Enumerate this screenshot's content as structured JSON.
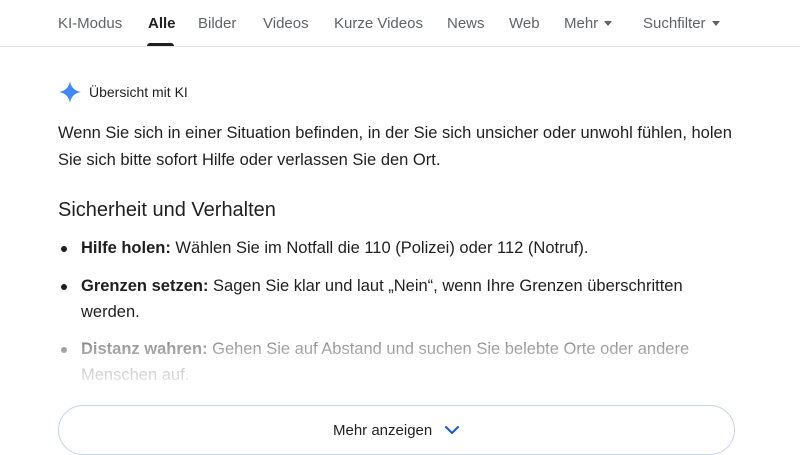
{
  "tabs": [
    {
      "label": "KI-Modus"
    },
    {
      "label": "Alle",
      "active": true
    },
    {
      "label": "Bilder"
    },
    {
      "label": "Videos"
    },
    {
      "label": "Kurze Videos"
    },
    {
      "label": "News"
    },
    {
      "label": "Web"
    },
    {
      "label": "Mehr",
      "dropdown": true
    },
    {
      "label": "Suchfilter",
      "dropdown": true
    }
  ],
  "ai_overview": {
    "icon": "sparkle-icon",
    "label": "Übersicht mit KI",
    "intro": "Wenn Sie sich in einer Situation befinden, in der Sie sich unsicher oder unwohl fühlen, holen Sie sich bitte sofort Hilfe oder verlassen Sie den Ort.",
    "section_title": "Sicherheit und Verhalten",
    "bullets": [
      {
        "title": "Hilfe holen:",
        "text": " Wählen Sie im Notfall die 110 (Polizei) oder 112 (Notruf)."
      },
      {
        "title": "Grenzen setzen:",
        "text": " Sagen Sie klar und laut „Nein“, wenn Ihre Grenzen überschritten werden."
      },
      {
        "title": "Distanz wahren:",
        "text": " Gehen Sie auf Abstand und suchen Sie belebte Orte oder andere Menschen auf."
      }
    ],
    "more_button": "Mehr anzeigen"
  },
  "colors": {
    "sparkle": "#4285f4",
    "text": "#1f1f1f",
    "muted": "#5f6368",
    "button_border": "#c5d3e8"
  }
}
